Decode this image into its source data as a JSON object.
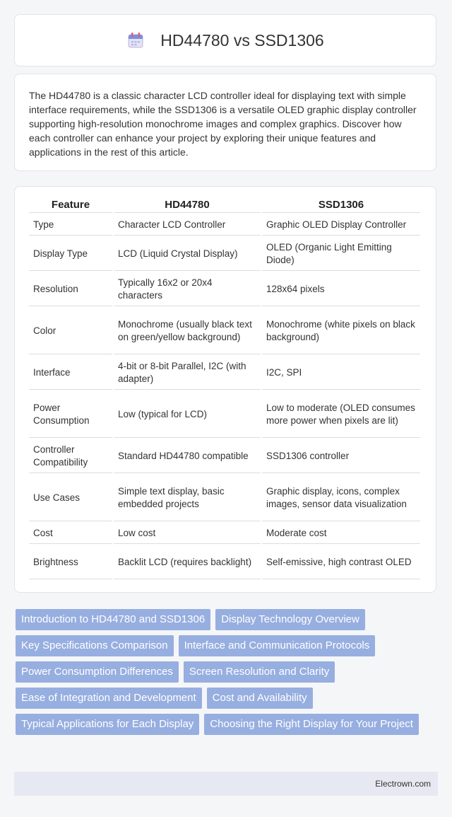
{
  "header": {
    "title": "HD44780 vs SSD1306"
  },
  "intro": "The HD44780 is a classic character LCD controller ideal for displaying text with simple interface requirements, while the SSD1306 is a versatile OLED graphic display controller supporting high-resolution monochrome images and complex graphics. Discover how each controller can enhance your project by exploring their unique features and applications in the rest of this article.",
  "table": {
    "headers": [
      "Feature",
      "HD44780",
      "SSD1306"
    ],
    "rows": [
      [
        "Type",
        "Character LCD Controller",
        "Graphic OLED Display Controller"
      ],
      [
        "Display Type",
        "LCD (Liquid Crystal Display)",
        "OLED (Organic Light Emitting Diode)"
      ],
      [
        "Resolution",
        "Typically 16x2 or 20x4 characters",
        "128x64 pixels"
      ],
      [
        "Color",
        "Monochrome (usually black text on green/yellow background)",
        "Monochrome (white pixels on black background)"
      ],
      [
        "Interface",
        "4-bit or 8-bit Parallel, I2C (with adapter)",
        "I2C, SPI"
      ],
      [
        "Power Consumption",
        "Low (typical for LCD)",
        "Low to moderate (OLED consumes more power when pixels are lit)"
      ],
      [
        "Controller Compatibility",
        "Standard HD44780 compatible",
        "SSD1306 controller"
      ],
      [
        "Use Cases",
        "Simple text display, basic embedded projects",
        "Graphic display, icons, complex images, sensor data visualization"
      ],
      [
        "Cost",
        "Low cost",
        "Moderate cost"
      ],
      [
        "Brightness",
        "Backlit LCD (requires backlight)",
        "Self-emissive, high contrast OLED"
      ]
    ]
  },
  "tags": [
    "Introduction to HD44780 and SSD1306",
    "Display Technology Overview",
    "Key Specifications Comparison",
    "Interface and Communication Protocols",
    "Power Consumption Differences",
    "Screen Resolution and Clarity",
    "Ease of Integration and Development",
    "Cost and Availability",
    "Typical Applications for Each Display",
    "Choosing the Right Display for Your Project"
  ],
  "footer": {
    "brand": "Electrown.com"
  },
  "colors": {
    "tag_bg": "#97aee0",
    "footer_bg": "#e6e9f2"
  },
  "icons": {
    "title": "calendar-icon"
  }
}
